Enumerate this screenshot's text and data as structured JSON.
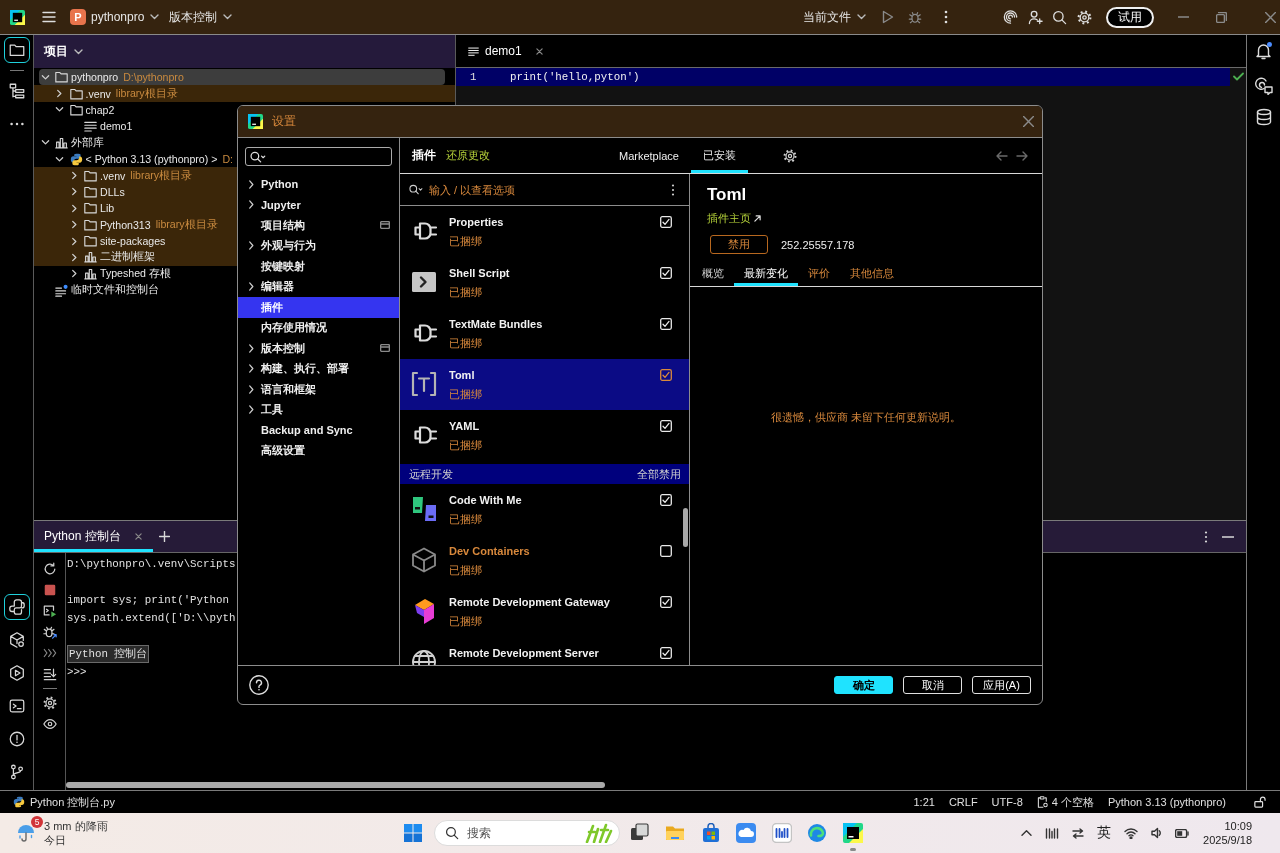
{
  "title_bar": {
    "project_initial": "P",
    "project": "pythonpro",
    "vcs": "版本控制",
    "run_config": "当前文件",
    "trial_button": "试用"
  },
  "tool_strip": {
    "top": [
      {
        "selected": true
      },
      {
        "selected": false
      },
      {
        "selected": false
      }
    ],
    "bottom": [
      {
        "selected": true
      },
      {
        "selected": false
      },
      {
        "selected": false
      },
      {
        "selected": false
      },
      {
        "selected": false
      },
      {
        "selected": false
      }
    ]
  },
  "project_panel": {
    "title": "项目",
    "tree": [
      {
        "kind": "folder",
        "label": "pythonpro",
        "hint": "D:\\pythonpro",
        "expanded": true,
        "selected": true,
        "highlighted": false,
        "children": [
          {
            "kind": "folder",
            "label": ".venv",
            "hint": "library根目录",
            "expanded": false,
            "selected": false,
            "highlighted": true
          },
          {
            "kind": "folder",
            "label": "chap2",
            "expanded": true,
            "selected": false,
            "highlighted": false,
            "children": [
              {
                "kind": "file",
                "label": "demo1",
                "selected": false,
                "highlighted": false
              }
            ]
          }
        ]
      },
      {
        "kind": "library",
        "label": "外部库",
        "expanded": true,
        "selected": false,
        "highlighted": false,
        "children": [
          {
            "kind": "python",
            "label": "< Python 3.13 (pythonpro) >",
            "hint": "D:",
            "expanded": true,
            "selected": false,
            "highlighted": false,
            "children": [
              {
                "kind": "folder",
                "label": ".venv",
                "hint": "library根目录",
                "expanded": false,
                "selected": false,
                "highlighted": true
              },
              {
                "kind": "folder",
                "label": "DLLs",
                "expanded": false,
                "selected": false,
                "highlighted": true
              },
              {
                "kind": "folder",
                "label": "Lib",
                "expanded": false,
                "selected": false,
                "highlighted": true
              },
              {
                "kind": "folder",
                "label": "Python313",
                "hint": "library根目录",
                "expanded": false,
                "selected": false,
                "highlighted": true
              },
              {
                "kind": "folder",
                "label": "site-packages",
                "expanded": false,
                "selected": false,
                "highlighted": true
              },
              {
                "kind": "library",
                "label": "二进制框架",
                "expanded": false,
                "selected": false,
                "highlighted": true
              },
              {
                "kind": "library",
                "label": "Typeshed 存根",
                "expanded": false,
                "selected": false,
                "highlighted": false
              }
            ]
          }
        ]
      },
      {
        "kind": "scratch",
        "label": "临时文件和控制台",
        "selected": false,
        "highlighted": false
      }
    ]
  },
  "editor": {
    "tabs": [
      {
        "label": "demo1",
        "selected": true
      }
    ],
    "lines": [
      {
        "number": "1",
        "code": "print('hello,pyton')",
        "current": true
      }
    ]
  },
  "console_panel": {
    "tabs": [
      {
        "label": "Python 控制台",
        "selected": true
      }
    ],
    "lines": [
      {
        "kind": "output",
        "text": "D:\\pythonpro\\.venv\\Scripts"
      },
      {
        "kind": "command",
        "text": "import sys; print('Python"
      },
      {
        "kind": "command",
        "text": "sys.path.extend(['D:\\\\pyth"
      },
      {
        "kind": "banner",
        "text": "Python 控制台"
      },
      {
        "kind": "prompt",
        "text": ">>>"
      }
    ]
  },
  "status_bar": {
    "file": "Python 控制台.py",
    "items": [
      {
        "kind": "text",
        "text": "1:21"
      },
      {
        "kind": "text",
        "text": "CRLF"
      },
      {
        "kind": "text",
        "text": "UTF-8"
      },
      {
        "kind": "indent",
        "text": "4 个空格"
      },
      {
        "kind": "text",
        "text": "Python 3.13 (pythonpro)"
      }
    ]
  },
  "taskbar": {
    "weather": {
      "badge": "5",
      "text": "3 mm 的降雨",
      "day": "今日"
    },
    "search": {
      "placeholder": "搜索"
    },
    "apps": [
      {
        "running": false
      },
      {
        "running": false
      },
      {
        "running": false
      },
      {
        "running": false
      },
      {
        "running": false
      },
      {
        "running": false
      },
      {
        "running": true
      }
    ],
    "ime": "英",
    "time": "10:09",
    "date": "2025/9/18"
  },
  "dialog": {
    "title": "设置",
    "nav": [
      {
        "label": "Python",
        "expanded": false,
        "project_scope": false,
        "selected": false
      },
      {
        "label": "Jupyter",
        "expanded": false,
        "project_scope": false,
        "selected": false
      },
      {
        "label": "项目结构",
        "project_scope": true,
        "selected": false
      },
      {
        "label": "外观与行为",
        "expanded": false,
        "project_scope": false,
        "selected": false
      },
      {
        "label": "按键映射",
        "project_scope": false,
        "selected": false
      },
      {
        "label": "编辑器",
        "expanded": false,
        "project_scope": false,
        "selected": false
      },
      {
        "label": "插件",
        "project_scope": false,
        "selected": true
      },
      {
        "label": "内存使用情况",
        "project_scope": false,
        "selected": false
      },
      {
        "label": "版本控制",
        "expanded": false,
        "project_scope": true,
        "selected": false
      },
      {
        "label": "构建、执行、部署",
        "expanded": false,
        "project_scope": false,
        "selected": false
      },
      {
        "label": "语言和框架",
        "expanded": false,
        "project_scope": false,
        "selected": false
      },
      {
        "label": "工具",
        "expanded": false,
        "project_scope": false,
        "selected": false
      },
      {
        "label": "Backup and Sync",
        "project_scope": false,
        "selected": false
      },
      {
        "label": "高级设置",
        "project_scope": false,
        "selected": false
      }
    ],
    "plugins": {
      "title": "插件",
      "reset": "还原更改",
      "tabs": [
        {
          "label": "Marketplace",
          "selected": false
        },
        {
          "label": "已安装",
          "selected": true
        }
      ],
      "search": {
        "placeholder": "输入 / 以查看选项"
      },
      "list": [
        {
          "kind": "plugin",
          "name": "Properties",
          "status": "已捆绑",
          "checked": true,
          "selected": false
        },
        {
          "kind": "plugin",
          "name": "Shell Script",
          "status": "已捆绑",
          "checked": true,
          "selected": false
        },
        {
          "kind": "plugin",
          "name": "TextMate Bundles",
          "status": "已捆绑",
          "checked": true,
          "selected": false
        },
        {
          "kind": "plugin",
          "name": "Toml",
          "status": "已捆绑",
          "checked": true,
          "selected": true
        },
        {
          "kind": "plugin",
          "name": "YAML",
          "status": "已捆绑",
          "checked": true,
          "selected": false
        },
        {
          "kind": "group",
          "name": "远程开发",
          "action": "全部禁用"
        },
        {
          "kind": "plugin",
          "name": "Code With Me",
          "status": "已捆绑",
          "checked": true,
          "selected": false
        },
        {
          "kind": "plugin",
          "name": "Dev Containers",
          "status": "已捆绑",
          "checked": false,
          "selected": false
        },
        {
          "kind": "plugin",
          "name": "Remote Development Gateway",
          "status": "已捆绑",
          "checked": true,
          "selected": false
        },
        {
          "kind": "plugin",
          "name": "Remote Development Server",
          "checked": true,
          "selected": false
        }
      ]
    },
    "detail": {
      "name": "Toml",
      "homepage": "插件主页",
      "disable_button": "禁用",
      "version": "252.25557.178",
      "tabs": [
        {
          "label": "概览",
          "selected": false,
          "disabled": false
        },
        {
          "label": "最新变化",
          "selected": true,
          "disabled": false
        },
        {
          "label": "评价",
          "selected": false,
          "disabled": true
        },
        {
          "label": "其他信息",
          "selected": false,
          "disabled": true
        }
      ],
      "message": "很遗憾，供应商 未留下任何更新说明。"
    },
    "buttons": [
      {
        "label": "确定",
        "default": true
      },
      {
        "label": "取消",
        "default": false
      },
      {
        "label": "应用(A)",
        "default": false
      }
    ]
  }
}
